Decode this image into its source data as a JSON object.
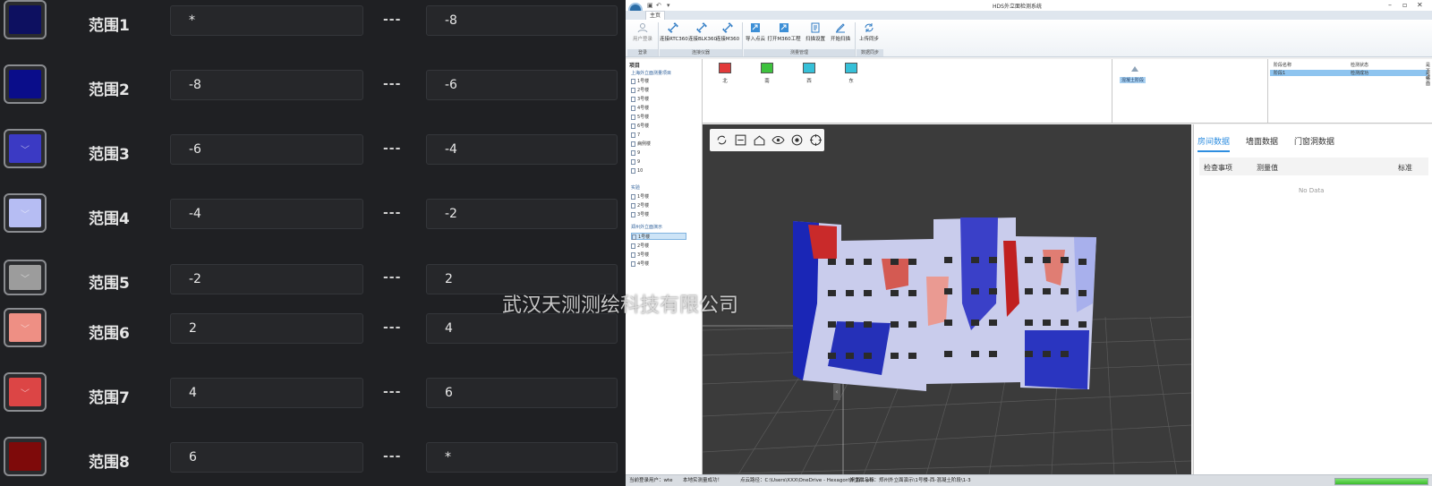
{
  "ranges": [
    {
      "label": "范围1",
      "from": "*",
      "to": "-8",
      "color": "#0d1060"
    },
    {
      "label": "范围2",
      "from": "-8",
      "to": "-6",
      "color": "#0a0d8a"
    },
    {
      "label": "范围3",
      "from": "-6",
      "to": "-4",
      "color": "#3b3ac4"
    },
    {
      "label": "范围4",
      "from": "-4",
      "to": "-2",
      "color": "#b6bdf3"
    },
    {
      "label": "范围5",
      "from": "-2",
      "to": "2",
      "color": "#9c9c9c"
    },
    {
      "label": "范围6",
      "from": "2",
      "to": "4",
      "color": "#ee8f84"
    },
    {
      "label": "范围7",
      "from": "4",
      "to": "6",
      "color": "#dc4545"
    },
    {
      "label": "范围8",
      "from": "6",
      "to": "*",
      "color": "#7e0a0a"
    }
  ],
  "range_separator": "---",
  "app": {
    "title": "HDS外立面检测系统",
    "tab_main": "主页",
    "ribbon": {
      "buttons": [
        "用户登录",
        "连接RTC360",
        "连接BLK360",
        "连接M360",
        "导入点云",
        "打开M360工程",
        "扫描设置",
        "开始扫描",
        "上传同步"
      ],
      "groups": [
        "登录",
        "连接仪器",
        "测量管理",
        "数据同步"
      ]
    },
    "tree": {
      "header": "项目",
      "group1": "上海外立面测量项目",
      "group1_items": [
        "1号楼",
        "2号楼",
        "3号楼",
        "4号楼",
        "5号楼",
        "6号楼",
        "7",
        "病例楼",
        "9",
        "9",
        "10"
      ],
      "group2": "实验",
      "group2_items": [
        "1号楼",
        "2号楼",
        "3号楼"
      ],
      "group3": "郑州外立面演示",
      "group3_items": [
        "1号楼",
        "2号楼",
        "3号楼",
        "4号楼"
      ]
    },
    "directions": [
      "北",
      "南",
      "西",
      "东"
    ],
    "stage_label": "混凝土阶段",
    "info": {
      "headers": [
        "阶段名称",
        "检测状态",
        "是否截面"
      ],
      "row": [
        "阶段1",
        "检测成功",
        "是否"
      ]
    },
    "data_tabs": [
      "房间数据",
      "墙面数据",
      "门窗洞数据"
    ],
    "data_headers": [
      "检查事项",
      "测量值",
      "标准"
    ],
    "no_data": "No Data",
    "status": {
      "user": "当前登录用户：wte",
      "msg": "本地实测量成功！",
      "path": "点云路径：C:\\Users\\XXX\\OneDrive - Hexagon\\桌面\\1.pts",
      "facade": "外立面名称：郑州外立面演示\\1号楼-西-混凝土阶段\\1-3"
    }
  },
  "watermark": "武汉天测测绘科技有限公司"
}
